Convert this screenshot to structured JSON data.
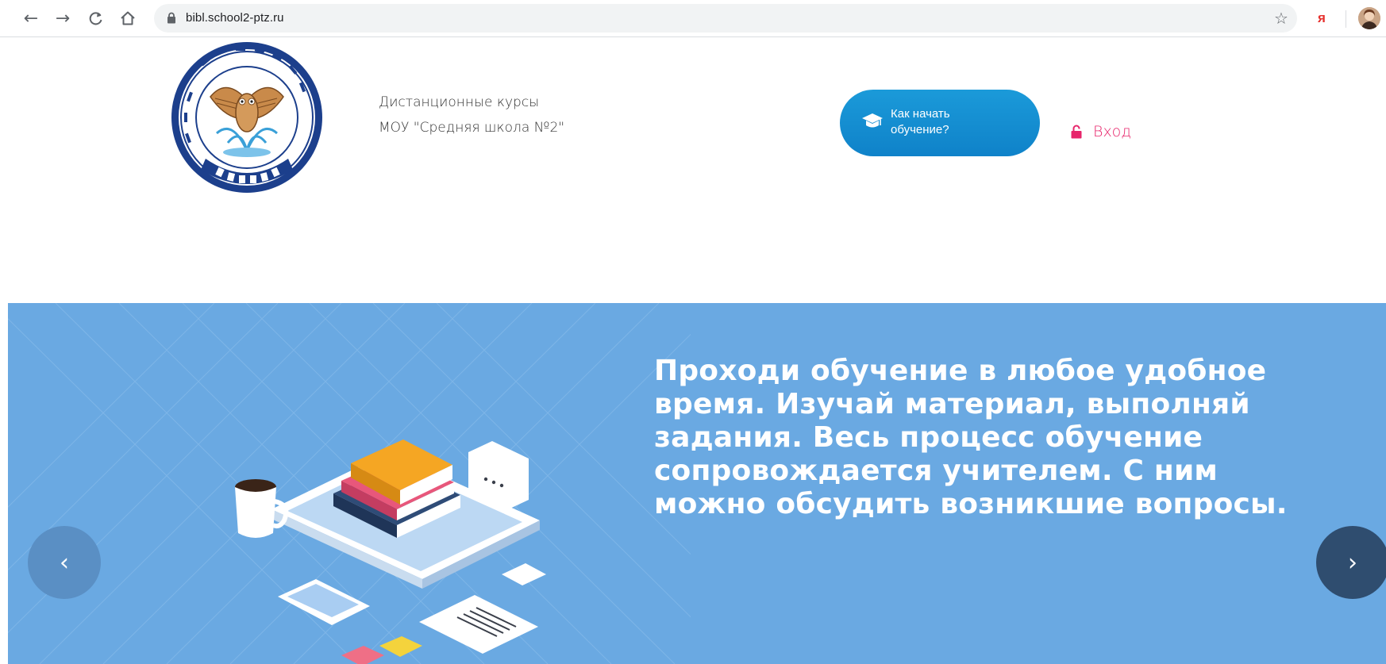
{
  "browser": {
    "url": "bibl.school2-ptz.ru",
    "back_icon": "arrow-left-icon",
    "forward_icon": "arrow-right-icon",
    "reload_icon": "reload-icon",
    "home_icon": "home-icon",
    "bookmark_icon": "star-icon",
    "extension_label": "я"
  },
  "header": {
    "logo_icon": "school-logo-icon",
    "title_line1": "Дистанционные курсы",
    "title_line2": "МОУ \"Средняя школа №2\"",
    "start_button_line1": "Как начать",
    "start_button_line2": "обучение?",
    "login_label": "Вход"
  },
  "slider": {
    "text": "Проходи обучение в любое удобное время. Изучай материал, выполняй задания. Весь процесс обучение сопровождается учителем. С ним можно обсудить возникшие вопросы.",
    "prev_label": "‹",
    "next_label": "›",
    "illustration_icon": "books-tablet-illustration"
  },
  "colors": {
    "slider_bg": "#6aa9e2",
    "button_blue": "#1592d3",
    "login_pink": "#e7256b"
  }
}
